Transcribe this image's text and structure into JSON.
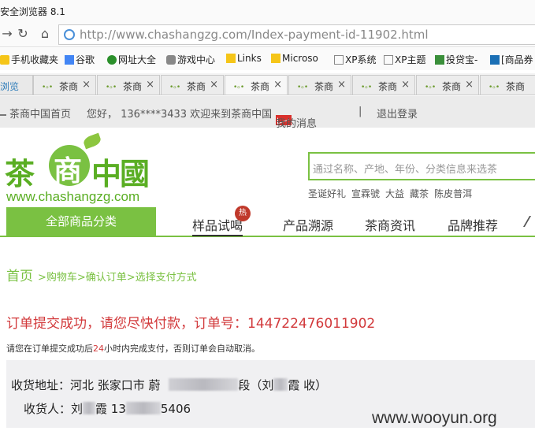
{
  "browser": {
    "title": "安全浏览器 8.1",
    "url_host": "http://www.chashangzg.com",
    "url_path": "/Index-payment-id-11902.html"
  },
  "bookmarks": [
    "手机收藏夹",
    "谷歌",
    "网址大全",
    "游戏中心",
    "Links",
    "Microso",
    "XP系统",
    "XP主题",
    "投贷宝-",
    "[商品券"
  ],
  "tabs": {
    "first": "浏览",
    "items": [
      "茶商",
      "茶商",
      "茶商",
      "茶商",
      "茶商",
      "茶商",
      "茶商",
      "茶商"
    ]
  },
  "topbar": {
    "home_link": "茶商中国首页",
    "greeting": "您好， 136****3433 欢迎来到茶商中国",
    "messages": "我的消息",
    "separator": "|",
    "logout": "退出登录"
  },
  "logo": {
    "chars_left": "茶",
    "char_circle": "商",
    "chars_right": "中國",
    "domain": "www.chashangzg.com"
  },
  "search": {
    "placeholder": "通过名称、产地、年份、分类信息来选茶",
    "hot": [
      "圣诞好礼",
      "宣霖號",
      "大益",
      "藏茶",
      "陈皮普洱"
    ]
  },
  "nav": {
    "all_categories": "全部商品分类",
    "items": [
      "样品试喝",
      "产品溯源",
      "茶商资讯",
      "品牌推荐"
    ],
    "hot_badge": "热"
  },
  "breadcrumb": {
    "home": "首页",
    "path": ">购物车>确认订单>选择支付方式"
  },
  "order": {
    "success": "订单提交成功，请您尽快付款，订单号：144722476011902",
    "notice_pre": "请您在订单提交成功后",
    "notice_hours": "24",
    "notice_post": "小时内完成支付，否则订单会自动取消。"
  },
  "address": {
    "line1_a": "收货地址：河北 张家口市 蔚",
    "line1_b": "段（刘",
    "line1_c": "霞 收）",
    "line2_a": "收货人：刘",
    "line2_b": "霞 13",
    "line2_c": "5406"
  },
  "watermark": "www.wooyun.org"
}
